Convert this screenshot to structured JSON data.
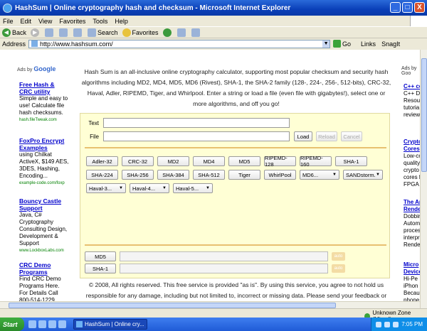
{
  "window": {
    "title": "HashSum | Online cryptography hash and checksum - Microsoft Internet Explorer",
    "minimize": "_",
    "maximize": "□",
    "close": "X"
  },
  "menu": [
    "File",
    "Edit",
    "View",
    "Favorites",
    "Tools",
    "Help"
  ],
  "toolbar": {
    "back": "Back",
    "search": "Search",
    "favorites": "Favorites"
  },
  "address": {
    "label": "Address",
    "url": "http://www.hashsum.com/",
    "go": "Go",
    "links": "Links",
    "snagit": "SnagIt"
  },
  "left_ads": {
    "adsby": "Ads by",
    "adsby_brand": "Google",
    "items": [
      {
        "title": "Free Hash & CRC utility",
        "desc": "Simple and easy to use! Calculate file hash checksums.",
        "url": "hash.fileTweak.com"
      },
      {
        "title": "FoxPro Encrypt Examples",
        "desc": "using Chilkat ActiveX, $149 AES, 3DES, Hashing, Encoding...",
        "url": "example-code.com/foxp"
      },
      {
        "title": "Bouncy Castle Support",
        "desc": "Java, C# Cryptography Consulting Design, Development & Support",
        "url": "www.LockboxLabs.com"
      },
      {
        "title": "CRC Demo Programs",
        "desc": "Find CRC Demo Programs Here. For Details Call 800-514-1229 Now!",
        "url": ""
      }
    ]
  },
  "right_ads": {
    "adsby": "Ads by Goo",
    "items": [
      {
        "title": "C++ co",
        "desc": "C++ D Resou tutoria reviews"
      },
      {
        "title": "Crypto Cores",
        "desc": "Low-co quality crypto cores f FPGA"
      },
      {
        "title": "The Ar Render",
        "desc": "Dobbin Autom proces interpr Render"
      },
      {
        "title": "Micro Device",
        "desc": "Hi-Pe iPhon Becau phone"
      }
    ]
  },
  "intro": "Hash Sum is an all-inclusive online cryptography calculator, supporting most popular checksum and security hash algorithms including MD2, MD4, MD5, MD6 (Rivest), SHA-1, the SHA-2 family (128-, 224-, 256-, 512-bits), CRC-32, Haval, Adler, RIPEMD, Tiger, and Whirlpool. Enter a string or load a file (even file with gigabytes!), select one or more algorithms, and off you go!",
  "form": {
    "text_label": "Text",
    "file_label": "File",
    "load": "Load",
    "reload": "Reload",
    "cancel": "Cancel"
  },
  "algorithms": [
    "Adler-32",
    "CRC-32",
    "MD2",
    "MD4",
    "MD5",
    "RIPEMD-128",
    "RIPEMD-160",
    "SHA-1",
    "SHA-224",
    "SHA-256",
    "SHA-384",
    "SHA-512",
    "Tiger",
    "WhirlPool"
  ],
  "selects": [
    "MD6...",
    "SANDstorm.",
    "Haval-3...",
    "Haval-4...",
    "Haval-5..."
  ],
  "results": [
    {
      "name": "MD5",
      "action": "auto"
    },
    {
      "name": "SHA-1",
      "action": "auto"
    }
  ],
  "footer": "© 2008, All rights reserved. This free service is provided \"as is\". By using this service, you agree to not hold us responsible for any damage, including but not limited to, incorrect or missing data. Please send your feedback or",
  "status": {
    "zone": "Unknown Zone (Mixed)"
  },
  "taskbar": {
    "start": "Start",
    "task": "HashSum | Online cry...",
    "time": "7:05 PM"
  }
}
